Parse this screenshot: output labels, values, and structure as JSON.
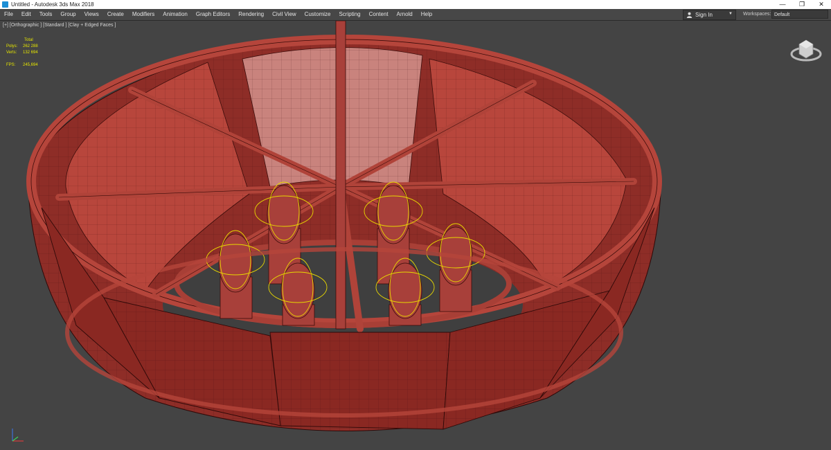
{
  "window": {
    "title": "Untitled - Autodesk 3ds Max 2018",
    "controls": [
      "—",
      "❐",
      "✕"
    ]
  },
  "menu": [
    "File",
    "Edit",
    "Tools",
    "Group",
    "Views",
    "Create",
    "Modifiers",
    "Animation",
    "Graph Editors",
    "Rendering",
    "Civil View",
    "Customize",
    "Scripting",
    "Content",
    "Arnold",
    "Help"
  ],
  "signin": {
    "label": "Sign In",
    "icon": "person-icon"
  },
  "workspaces": {
    "label": "Workspaces:",
    "value": "Default"
  },
  "viewport": {
    "label": "[+] [Orthographic ] [Standard ] [Clay + Edged Faces ]",
    "stats": {
      "header": "Total",
      "polys_label": "Polys:",
      "polys": "262 288",
      "verts_label": "Verts:",
      "verts": "132 694",
      "fps_label": "FPS:",
      "fps": "245,694"
    },
    "background": "#444444"
  },
  "colors": {
    "clay": "#b8463c",
    "clay_dark": "#7a2420",
    "clay_light": "#d67a72",
    "gizmo": "#e8d800",
    "menubar": "#474747"
  }
}
